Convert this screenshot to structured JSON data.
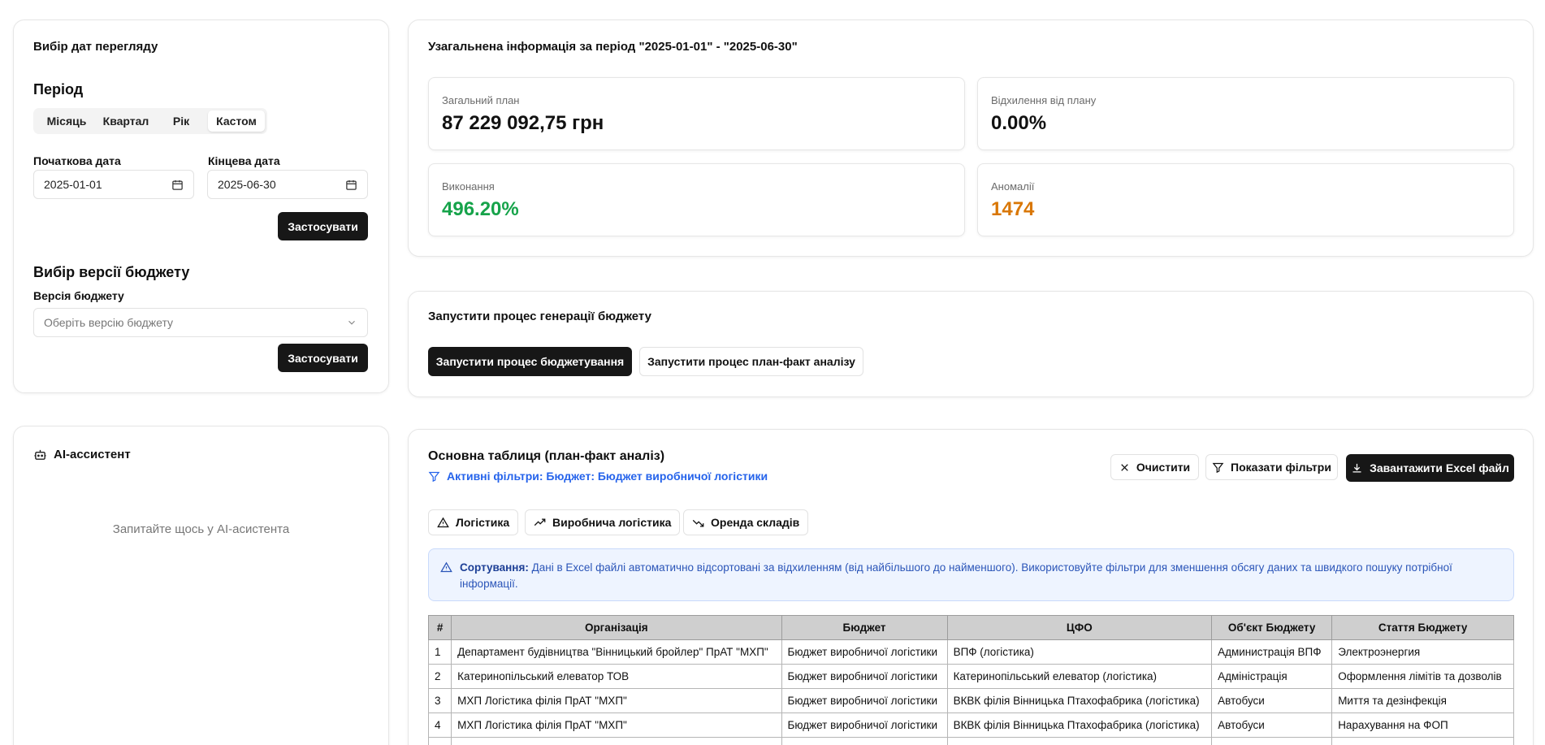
{
  "dates_card": {
    "title": "Вибір дат перегляду",
    "period_heading": "Період",
    "period_tabs": [
      "Місяць",
      "Квартал",
      "Рік",
      "Кастом"
    ],
    "active_tab": "Кастом",
    "start_label": "Початкова дата",
    "start_value": "2025-01-01",
    "end_label": "Кінцева дата",
    "end_value": "2025-06-30",
    "apply_label": "Застосувати",
    "budget_heading": "Вибір версії бюджету",
    "budget_label": "Версія бюджету",
    "budget_placeholder": "Оберіть версію бюджету",
    "budget_apply_label": "Застосувати"
  },
  "summary": {
    "title": "Узагальнена інформація за період \"2025-01-01\" - \"2025-06-30\"",
    "stats": [
      {
        "caption": "Загальний план",
        "value": "87 229 092,75 грн",
        "color": "#111111"
      },
      {
        "caption": "Відхилення від плану",
        "value": "0.00%",
        "color": "#111111"
      },
      {
        "caption": "Виконання",
        "value": "496.20%",
        "color": "#16a34a"
      },
      {
        "caption": "Аномалії",
        "value": "1474",
        "color": "#d97706"
      }
    ]
  },
  "generation": {
    "title": "Запустити процес генерації бюджету",
    "primary_button": "Запустити процес бюджетування",
    "secondary_button": "Запустити процес план-факт аналізу"
  },
  "assistant": {
    "title": "AI-ассистент",
    "placeholder": "Запитайте щось у AI-асистента"
  },
  "main_table": {
    "title": "Основна таблиця (план-факт аналіз)",
    "active_filters": "Активні фільтри: Бюджет: Бюджет виробничої логістики",
    "clear_button": "Очистити",
    "filters_button": "Показати фільтри",
    "download_button": "Завантажити Excel файл",
    "chips": [
      "Логістика",
      "Виробнича логістика",
      "Оренда складів"
    ],
    "info_bold": "Сортування:",
    "info_text": " Дані в Excel файлі автоматично відсортовані за відхиленням (від найбільшого до найменшого). Використовуйте фільтри для зменшення обсягу даних та швидкого пошуку потрібної інформації.",
    "columns": [
      "#",
      "Організація",
      "Бюджет",
      "ЦФО",
      "Об'єкт Бюджету",
      "Стаття Бюджету"
    ],
    "rows": [
      [
        "1",
        "Департамент будівництва \"Вінницький бройлер\" ПрАТ \"МХП\"",
        "Бюджет виробничої логістики",
        "ВПФ (логістика)",
        "Администрація ВПФ",
        "Электроэнергия"
      ],
      [
        "2",
        "Катеринопільський елеватор ТОВ",
        "Бюджет виробничої логістики",
        "Катеринопільський елеватор (логістика)",
        "Адміністрація",
        "Оформлення лімітів та дозволів"
      ],
      [
        "3",
        "МХП Логістика філія ПрАТ \"МХП\"",
        "Бюджет виробничої логістики",
        "ВКВК філія Вінницька Птахофабрика (логістика)",
        "Автобуси",
        "Миття та дезінфекція"
      ],
      [
        "4",
        "МХП Логістика філія ПрАТ \"МХП\"",
        "Бюджет виробничої логістики",
        "ВКВК філія Вінницька Птахофабрика (логістика)",
        "Автобуси",
        "Нарахування на ФОП"
      ],
      [
        "",
        "",
        "",
        "",
        "",
        ""
      ]
    ]
  }
}
